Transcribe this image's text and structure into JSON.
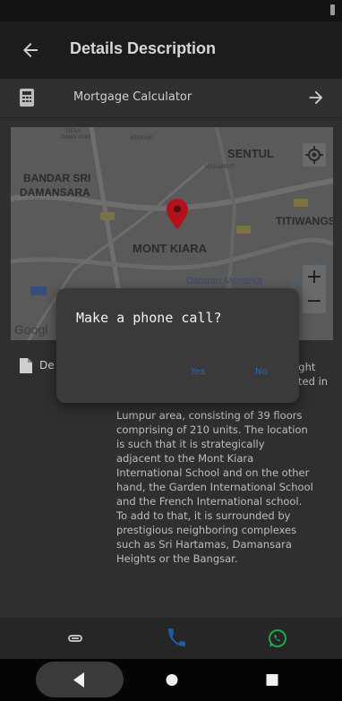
{
  "appbar": {
    "title": "Details Description"
  },
  "mortgage": {
    "label": "Mortgage Calculator"
  },
  "map": {
    "places": {
      "desa": "DESA",
      "awan_puri": "AWAN PURI",
      "kepong": "KEPONG",
      "sentul": "SENTUL",
      "bandar_sri": "BANDAR SRI",
      "damansara": "DAMANSARA",
      "segambut": "SEGAMBUT",
      "titiwangsa": "TITIWANGS",
      "mont_kiara": "MONT KIARA",
      "dataran": "Dataran Merdeka"
    },
    "attribution": "Googl",
    "zoom_in": "+",
    "zoom_out": "−"
  },
  "description": {
    "label": "De",
    "partial_right": [
      "ught",
      "ated in"
    ],
    "lines": [
      "Lumpur area, consisting of 39 floors",
      "comprising of 210 units. The location",
      "is such that it is strategically",
      "adjacent to the Mont Kiara",
      "International School and on the other",
      "hand, the Garden International School",
      "and the French International school.",
      "To add to that, it is surrounded by",
      "prestigious neighboring complexes",
      "such as Sri Hartamas, Damansara",
      "Heights or the Bangsar."
    ]
  },
  "dialog": {
    "title": "Make a phone call?",
    "yes": "Yes",
    "no": "No"
  },
  "colors": {
    "accent": "#2a67b8",
    "whatsapp": "#1fa64a",
    "phone": "#1e5aa8",
    "map_pin": "#b3121b"
  }
}
